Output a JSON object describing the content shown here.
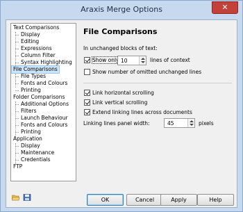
{
  "window": {
    "title": "Araxis Merge Options",
    "close_glyph": "✕"
  },
  "tree": {
    "items": [
      {
        "label": "Text Comparisons",
        "level": 0
      },
      {
        "label": "Display",
        "level": 1
      },
      {
        "label": "Editing",
        "level": 1
      },
      {
        "label": "Expressions",
        "level": 1
      },
      {
        "label": "Column Filter",
        "level": 1
      },
      {
        "label": "Syntax Highlighting",
        "level": 1
      },
      {
        "label": "File Comparisons",
        "level": 0,
        "selected": true
      },
      {
        "label": "File Types",
        "level": 1
      },
      {
        "label": "Fonts and Colours",
        "level": 1
      },
      {
        "label": "Printing",
        "level": 1
      },
      {
        "label": "Folder Comparisons",
        "level": 0
      },
      {
        "label": "Additional Options",
        "level": 1
      },
      {
        "label": "Filters",
        "level": 1
      },
      {
        "label": "Launch Behaviour",
        "level": 1
      },
      {
        "label": "Fonts and Colours",
        "level": 1
      },
      {
        "label": "Printing",
        "level": 1
      },
      {
        "label": "Application",
        "level": 0
      },
      {
        "label": "Display",
        "level": 1
      },
      {
        "label": "Maintenance",
        "level": 1
      },
      {
        "label": "Credentials",
        "level": 1
      },
      {
        "label": "FTP",
        "level": 0
      }
    ]
  },
  "panel": {
    "title": "File Comparisons",
    "section_label": "In unchanged blocks of text:",
    "show_only_label": "Show only",
    "show_only_checked": true,
    "context_value": "10",
    "context_suffix": "lines of context",
    "show_omitted_label": "Show number of omitted unchanged lines",
    "show_omitted_checked": false,
    "link_horizontal_label": "Link horizontal scrolling",
    "link_horizontal_checked": true,
    "link_vertical_label": "Link vertical scrolling",
    "link_vertical_checked": true,
    "extend_lines_label": "Extend linking lines across documents",
    "extend_lines_checked": true,
    "panel_width_label": "Linking lines panel width:",
    "panel_width_value": "45",
    "panel_width_suffix": "pixels"
  },
  "footer": {
    "icons": [
      "open-folder-icon",
      "save-icon"
    ],
    "ok_label": "OK",
    "cancel_label": "Cancel",
    "apply_label": "Apply",
    "help_label": "Help"
  },
  "colors": {
    "window_frame": "#c6d9ee",
    "close_button": "#c4413a",
    "selection": "#cde3f8",
    "default_button_border": "#3c7fb1"
  }
}
